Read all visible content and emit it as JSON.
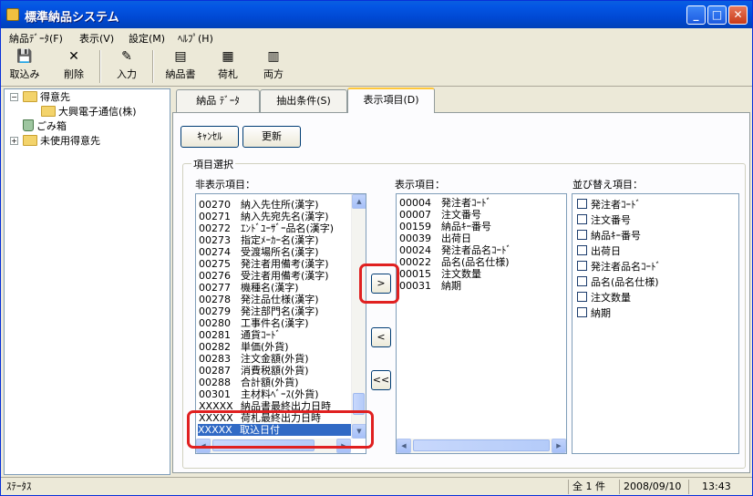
{
  "window": {
    "title": "標準納品システム",
    "min": "_",
    "max": "□",
    "close": "✕"
  },
  "menu": [
    "納品ﾃﾞｰﾀ(F)",
    "表示(V)",
    "設定(M)",
    "ﾍﾙﾌﾟ(H)"
  ],
  "toolbar": {
    "import": {
      "label": "取込み",
      "icon": "import-icon"
    },
    "delete": {
      "label": "削除",
      "icon": "delete-icon"
    },
    "input": {
      "label": "入力",
      "icon": "input-icon"
    },
    "invoice": {
      "label": "納品書",
      "icon": "invoice-icon"
    },
    "tag": {
      "label": "荷札",
      "icon": "tag-icon"
    },
    "both": {
      "label": "両方",
      "icon": "both-icon"
    }
  },
  "tree": {
    "root": "得意先",
    "child": "大興電子通信(株)",
    "trash": "ごみ箱",
    "unused": "未使用得意先"
  },
  "tabs": [
    "納品 ﾃﾞｰﾀ",
    "抽出条件(S)",
    "表示項目(D)"
  ],
  "buttons": {
    "cancel": "ｷｬﾝｾﾙ",
    "update": "更新"
  },
  "group_title": "項目選択",
  "hidden_label": "非表示項目：",
  "hidden_items": [
    [
      "00270",
      "納入先住所(漢字)"
    ],
    [
      "00271",
      "納入先宛先名(漢字)"
    ],
    [
      "00272",
      "ｴﾝﾄﾞﾕｰｻﾞｰ品名(漢字)"
    ],
    [
      "00273",
      "指定ﾒｰｶｰ名(漢字)"
    ],
    [
      "00274",
      "受渡場所名(漢字)"
    ],
    [
      "00275",
      "発注者用備考(漢字)"
    ],
    [
      "00276",
      "受注者用備考(漢字)"
    ],
    [
      "00277",
      "機種名(漢字)"
    ],
    [
      "00278",
      "発注品仕様(漢字)"
    ],
    [
      "00279",
      "発注部門名(漢字)"
    ],
    [
      "00280",
      "工事件名(漢字)"
    ],
    [
      "00281",
      "通貨ｺｰﾄﾞ"
    ],
    [
      "00282",
      "単価(外貨)"
    ],
    [
      "00283",
      "注文金額(外貨)"
    ],
    [
      "00287",
      "消費税額(外貨)"
    ],
    [
      "00288",
      "合計額(外貨)"
    ],
    [
      "00301",
      "主材料ﾍﾞｰｽ(外貨)"
    ],
    [
      "XXXXX",
      "納品書最終出力日時"
    ],
    [
      "XXXXX",
      "荷札最終出力日時"
    ],
    [
      "XXXXX",
      "取込日付"
    ]
  ],
  "shown_label": "表示項目：",
  "shown_items": [
    [
      "00004",
      "発注者ｺｰﾄﾞ"
    ],
    [
      "00007",
      "注文番号"
    ],
    [
      "00159",
      "納品ｷｰ番号"
    ],
    [
      "00039",
      "出荷日"
    ],
    [
      "00024",
      "発注者品名ｺｰﾄﾞ"
    ],
    [
      "00022",
      "品名(品名仕様)"
    ],
    [
      "00015",
      "注文数量"
    ],
    [
      "00031",
      "納期"
    ]
  ],
  "sort_label": "並び替え項目：",
  "sort_items": [
    "発注者ｺｰﾄﾞ",
    "注文番号",
    "納品ｷｰ番号",
    "出荷日",
    "発注者品名ｺｰﾄﾞ",
    "品名(品名仕様)",
    "注文数量",
    "納期"
  ],
  "move_buttons": {
    "add": ">",
    "remove": "<",
    "remove_all": "<<"
  },
  "status": {
    "text": "ｽﾃｰﾀｽ",
    "count": "全 1 件",
    "date": "2008/09/10",
    "time": "13:43"
  },
  "colors": {
    "titlebar": "#0054E3",
    "selection": "#316AC5",
    "highlight": "#E02020"
  }
}
